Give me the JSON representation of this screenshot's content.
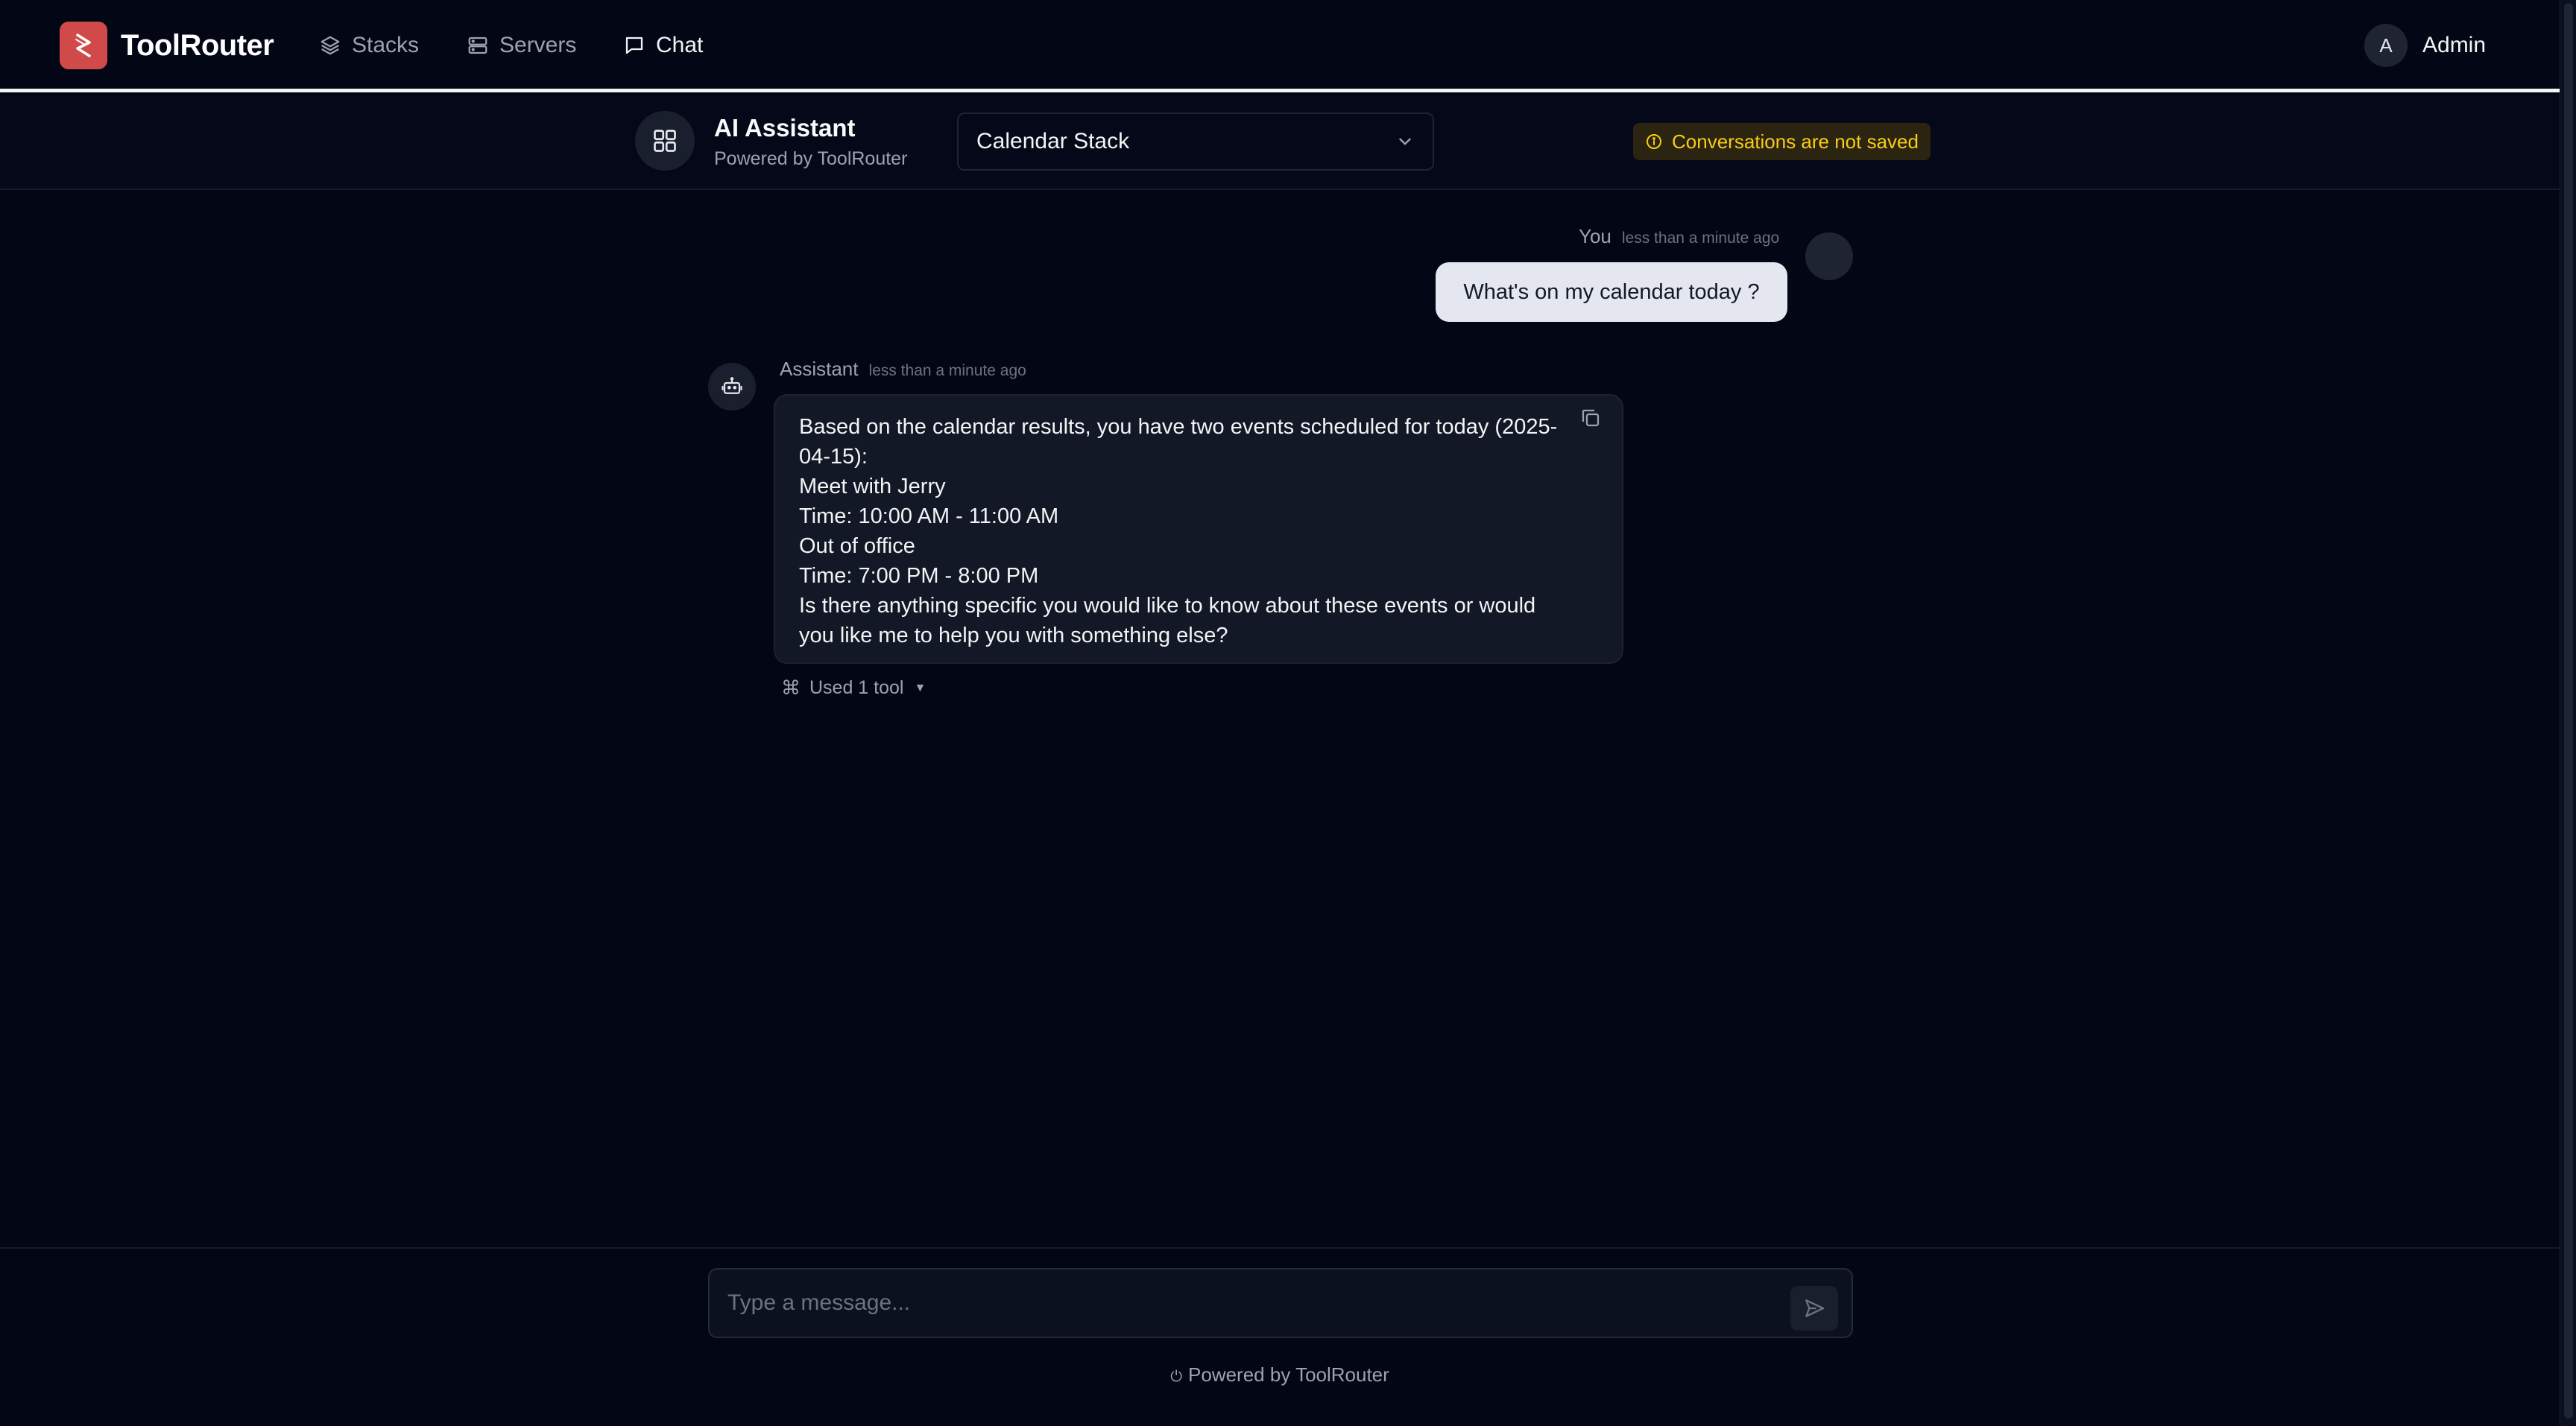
{
  "brand": {
    "name": "ToolRouter",
    "logo_icon": "toolrouter-logo-icon",
    "accent": "#d04a4a"
  },
  "nav": {
    "items": [
      {
        "label": "Stacks",
        "icon": "layers-icon",
        "active": false
      },
      {
        "label": "Servers",
        "icon": "server-icon",
        "active": false
      },
      {
        "label": "Chat",
        "icon": "chat-bubble-icon",
        "active": true
      }
    ]
  },
  "user": {
    "initial": "A",
    "name": "Admin"
  },
  "chat_header": {
    "title": "AI Assistant",
    "subtitle": "Powered by ToolRouter",
    "stack_selected": "Calendar Stack",
    "notice": "Conversations are not saved",
    "notice_color": "#facc15"
  },
  "messages": [
    {
      "role": "user",
      "author": "You",
      "time": "less than a minute ago",
      "text": "What's on my calendar today ?"
    },
    {
      "role": "assistant",
      "author": "Assistant",
      "time": "less than a minute ago",
      "lines": [
        "Based on the calendar results, you have two events scheduled for today (2025-",
        "04-15):",
        "Meet with Jerry",
        "Time: 10:00 AM - 11:00 AM",
        "Out of office",
        "Time: 7:00 PM - 8:00 PM",
        "Is there anything specific you would like to know about these events or would",
        "you like me to help you with something else?"
      ],
      "tool_summary": "Used 1 tool"
    }
  ],
  "composer": {
    "placeholder": "Type a message..."
  },
  "footer": {
    "text": "Powered by ToolRouter"
  }
}
